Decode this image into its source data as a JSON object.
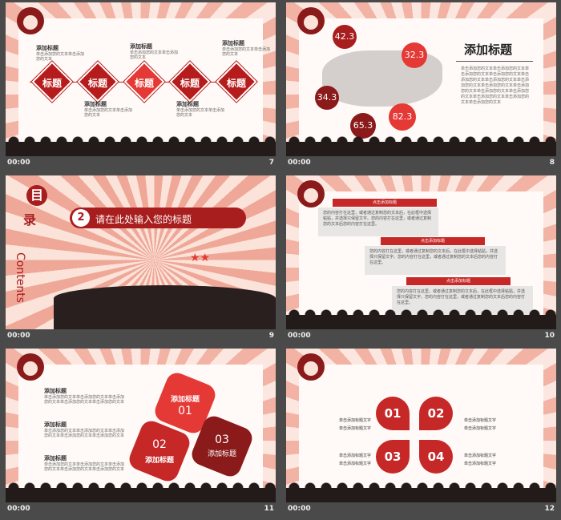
{
  "slides": [
    {
      "number": "7",
      "time": "00:00",
      "diamonds": [
        "标题",
        "标题",
        "标题",
        "标题",
        "标题"
      ],
      "top_notes": [
        {
          "heading": "添加标题",
          "text": "单击添加您的文本单击添加您的文本"
        },
        {
          "heading": "添加标题",
          "text": "单击添加您的文本单击添加您的文本"
        },
        {
          "heading": "添加标题",
          "text": "单击添加您的文本单击添加您的文本"
        }
      ],
      "bottom_notes": [
        {
          "heading": "添加标题",
          "text": "单击添加您的文本单击添加您的文本"
        },
        {
          "heading": "添加标题",
          "text": "单击添加您的文本单击添加您的文本"
        }
      ]
    },
    {
      "number": "8",
      "time": "00:00",
      "title": "添加标题",
      "bubbles": [
        "42.3",
        "32.3",
        "34.3",
        "65.3",
        "82.3"
      ],
      "body": "单击添加您的文本单击添加您的文本单击添加您的文本单击添加您的文本单击添加您的文本单击添加您的文本单击添加您的文本单击添加您的文本单击添加您的文本单击添加您的文本单击添加您的文本单击添加您的文本单击添加您的文本单击添加您的文本"
    },
    {
      "number": "9",
      "time": "00:00",
      "char1": "目",
      "char2": "录",
      "contents": "Contents",
      "item_num": "2",
      "item_text": "请在此处输入您的标题"
    },
    {
      "number": "10",
      "time": "00:00",
      "bars": [
        "点击添加标题",
        "点击添加标题",
        "点击添加标题"
      ],
      "boxes": [
        "您的内容打在这里，或者通过复制您的文本后，在此框中选择粘贴，并选择只保留文字。您的内容打在这里，或者通过复制您的文本后您的内容打在这里。",
        "您的内容打在这里，或者通过复制您的文本后，在此框中选择粘贴，并选择只保留文字。您的内容打在这里，或者通过复制您的文本后您的内容打在这里。",
        "您的内容打在这里，或者通过复制您的文本后，在此框中选择粘贴，并选择只保留文字。您的内容打在这里，或者通过复制您的文本后您的内容打在这里。"
      ]
    },
    {
      "number": "11",
      "time": "00:00",
      "notes": [
        {
          "heading": "添加标题",
          "text": "单击添加您的文本单击添加您的文本单击添加您的文本单击添加您的文本单击添加您的文本"
        },
        {
          "heading": "添加标题",
          "text": "单击添加您的文本单击添加您的文本单击添加您的文本单击添加您的文本单击添加您的文本"
        },
        {
          "heading": "添加标题",
          "text": "单击添加您的文本单击添加您的文本单击添加您的文本单击添加您的文本单击添加您的文本"
        }
      ],
      "stars": [
        {
          "title": "添加标题",
          "num": "01"
        },
        {
          "title": "添加标题",
          "num": "02"
        },
        {
          "title": "添加标题",
          "num": "03"
        }
      ]
    },
    {
      "number": "12",
      "time": "00:00",
      "petals": [
        "01",
        "02",
        "03",
        "04"
      ],
      "labels": [
        "单击添加标题文字",
        "单击添加标题文字",
        "单击添加标题文字",
        "单击添加标题文字"
      ]
    }
  ]
}
